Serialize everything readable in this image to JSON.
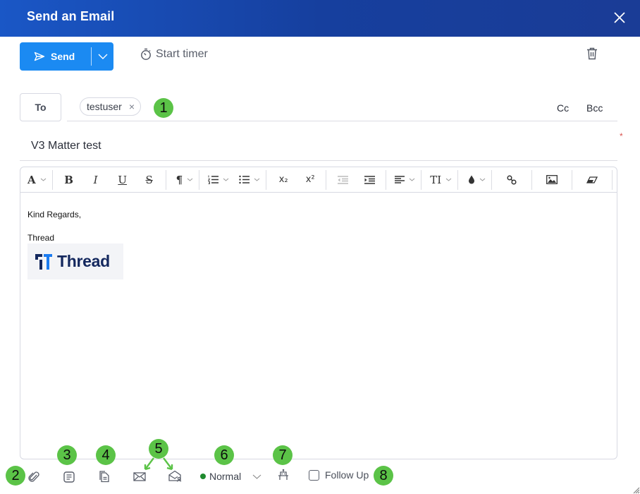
{
  "header": {
    "title": "Send an Email",
    "close_icon": "close-icon"
  },
  "actions": {
    "send_label": "Send",
    "send_dropdown_icon": "chevron-down-icon",
    "timer_label": "Start timer",
    "delete_icon": "trash-icon"
  },
  "recipients": {
    "to_label": "To",
    "to_chips": [
      {
        "label": "testuser",
        "remove_icon": "×"
      }
    ],
    "cc_label": "Cc",
    "bcc_label": "Bcc"
  },
  "subject": {
    "value": "V3 Matter test",
    "required_marker": "*"
  },
  "toolbar": {
    "groups": [
      [
        "font-color",
        "bold",
        "italic",
        "underline",
        "strikethrough"
      ],
      [
        "paragraph-format"
      ],
      [
        "ordered-list",
        "unordered-list"
      ],
      [
        "subscript",
        "superscript"
      ],
      [
        "outdent",
        "indent"
      ],
      [
        "align"
      ],
      [
        "font-size"
      ],
      [
        "color"
      ],
      [
        "link"
      ],
      [
        "image"
      ],
      [
        "clear-format"
      ]
    ],
    "labels": {
      "font": "A",
      "bold": "B",
      "italic": "I",
      "underline": "U",
      "strike": "S",
      "paragraph": "¶",
      "subscript": "x₂",
      "superscript": "x²",
      "font_size": "TI"
    }
  },
  "body": {
    "lines": [
      "Kind Regards,",
      "Thread"
    ],
    "logo_text": "Thread"
  },
  "footer": {
    "priority": {
      "label": "Normal",
      "color": "#1f8a2e"
    },
    "follow_up": {
      "label": "Follow Up",
      "checked": false
    }
  },
  "annotations": [
    "1",
    "2",
    "3",
    "4",
    "5",
    "6",
    "7",
    "8"
  ],
  "colors": {
    "header": "#1a4fb8",
    "send": "#1b8af2",
    "badge": "#5bc347"
  }
}
